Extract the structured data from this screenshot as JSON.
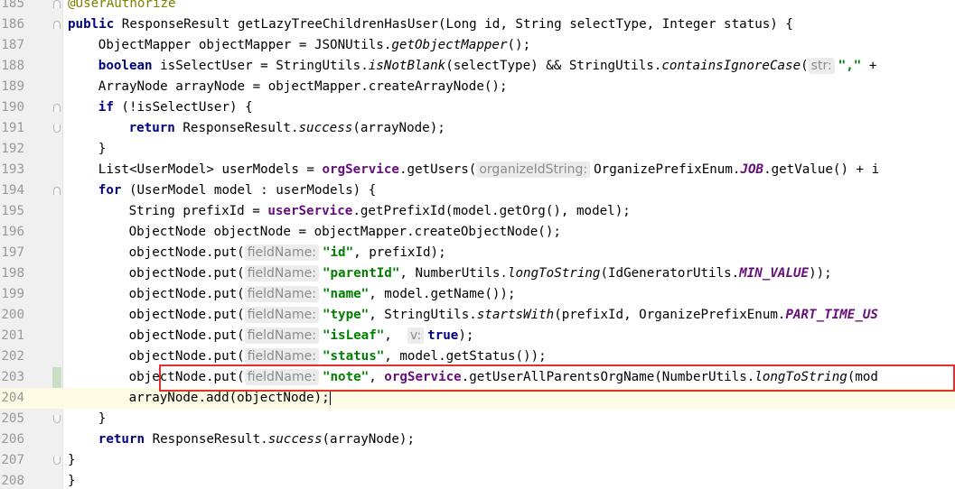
{
  "editor": {
    "lines": [
      {
        "num": "185",
        "indent": 1,
        "tokens": [
          {
            "t": "@UserAuthorize",
            "c": "ann"
          }
        ]
      },
      {
        "num": "186",
        "indent": 1,
        "tokens": [
          {
            "t": "public ",
            "c": "kw"
          },
          {
            "t": "ResponseResult getLazyTreeChildrenHasUser(Long id, String selectType, Integer status) {"
          }
        ]
      },
      {
        "num": "187",
        "indent": 2,
        "tokens": [
          {
            "t": "ObjectMapper objectMapper = JSONUtils."
          },
          {
            "t": "getObjectMapper",
            "c": "it"
          },
          {
            "t": "();"
          }
        ]
      },
      {
        "num": "188",
        "indent": 2,
        "tokens": [
          {
            "t": "boolean ",
            "c": "kw"
          },
          {
            "t": "isSelectUser = StringUtils."
          },
          {
            "t": "isNotBlank",
            "c": "it"
          },
          {
            "t": "(selectType) && StringUtils."
          },
          {
            "t": "containsIgnoreCase",
            "c": "it"
          },
          {
            "t": "("
          },
          {
            "t": "str:",
            "c": "hint"
          },
          {
            "t": "\",\"",
            "c": "str"
          },
          {
            "t": " +"
          }
        ]
      },
      {
        "num": "189",
        "indent": 2,
        "tokens": [
          {
            "t": "ArrayNode arrayNode = objectMapper.createArrayNode();"
          }
        ]
      },
      {
        "num": "190",
        "indent": 2,
        "tokens": [
          {
            "t": "if ",
            "c": "kw"
          },
          {
            "t": "(!isSelectUser) {"
          }
        ]
      },
      {
        "num": "191",
        "indent": 3,
        "tokens": [
          {
            "t": "return ",
            "c": "kw"
          },
          {
            "t": "ResponseResult."
          },
          {
            "t": "success",
            "c": "it"
          },
          {
            "t": "(arrayNode);"
          }
        ]
      },
      {
        "num": "192",
        "indent": 2,
        "tokens": [
          {
            "t": "}"
          }
        ]
      },
      {
        "num": "193",
        "indent": 2,
        "tokens": [
          {
            "t": "List<UserModel> userModels = "
          },
          {
            "t": "orgService",
            "c": "field"
          },
          {
            "t": ".getUsers("
          },
          {
            "t": "organizeIdString:",
            "c": "hint"
          },
          {
            "t": "OrganizePrefixEnum."
          },
          {
            "t": "JOB",
            "c": "const"
          },
          {
            "t": ".getValue() + i"
          }
        ]
      },
      {
        "num": "194",
        "indent": 2,
        "tokens": [
          {
            "t": "for ",
            "c": "kw"
          },
          {
            "t": "(UserModel model : userModels) {"
          }
        ]
      },
      {
        "num": "195",
        "indent": 3,
        "tokens": [
          {
            "t": "String prefixId = "
          },
          {
            "t": "userService",
            "c": "field"
          },
          {
            "t": ".getPrefixId(model.getOrg(), model);"
          }
        ]
      },
      {
        "num": "196",
        "indent": 3,
        "tokens": [
          {
            "t": "ObjectNode objectNode = objectMapper.createObjectNode();"
          }
        ]
      },
      {
        "num": "197",
        "indent": 3,
        "tokens": [
          {
            "t": "objectNode.put("
          },
          {
            "t": "fieldName:",
            "c": "hint"
          },
          {
            "t": "\"id\"",
            "c": "str"
          },
          {
            "t": ", prefixId);"
          }
        ]
      },
      {
        "num": "198",
        "indent": 3,
        "tokens": [
          {
            "t": "objectNode.put("
          },
          {
            "t": "fieldName:",
            "c": "hint"
          },
          {
            "t": "\"parentId\"",
            "c": "str"
          },
          {
            "t": ", NumberUtils."
          },
          {
            "t": "longToString",
            "c": "it"
          },
          {
            "t": "(IdGeneratorUtils."
          },
          {
            "t": "MIN_VALUE",
            "c": "const"
          },
          {
            "t": "));"
          }
        ]
      },
      {
        "num": "199",
        "indent": 3,
        "tokens": [
          {
            "t": "objectNode.put("
          },
          {
            "t": "fieldName:",
            "c": "hint"
          },
          {
            "t": "\"name\"",
            "c": "str"
          },
          {
            "t": ", model.getName());"
          }
        ]
      },
      {
        "num": "200",
        "indent": 3,
        "tokens": [
          {
            "t": "objectNode.put("
          },
          {
            "t": "fieldName:",
            "c": "hint"
          },
          {
            "t": "\"type\"",
            "c": "str"
          },
          {
            "t": ", StringUtils."
          },
          {
            "t": "startsWith",
            "c": "it"
          },
          {
            "t": "(prefixId, OrganizePrefixEnum."
          },
          {
            "t": "PART_TIME_US",
            "c": "const"
          }
        ]
      },
      {
        "num": "201",
        "indent": 3,
        "tokens": [
          {
            "t": "objectNode.put("
          },
          {
            "t": "fieldName:",
            "c": "hint"
          },
          {
            "t": "\"isLeaf\"",
            "c": "str"
          },
          {
            "t": ",  "
          },
          {
            "t": "v:",
            "c": "hint"
          },
          {
            "t": "true",
            "c": "kw"
          },
          {
            "t": ");"
          }
        ]
      },
      {
        "num": "202",
        "indent": 3,
        "tokens": [
          {
            "t": "objectNode.put("
          },
          {
            "t": "fieldName:",
            "c": "hint"
          },
          {
            "t": "\"status\"",
            "c": "str"
          },
          {
            "t": ", model.getStatus());"
          }
        ]
      },
      {
        "num": "203",
        "indent": 3,
        "tokens": [
          {
            "t": "objectNode.put("
          },
          {
            "t": "fieldName:",
            "c": "hint"
          },
          {
            "t": "\"note\"",
            "c": "str"
          },
          {
            "t": ", "
          },
          {
            "t": "orgService",
            "c": "field"
          },
          {
            "t": ".getUserAllParentsOrgName(NumberUtils."
          },
          {
            "t": "longToString",
            "c": "it"
          },
          {
            "t": "(mod"
          }
        ]
      },
      {
        "num": "204",
        "indent": 3,
        "tokens": [
          {
            "t": "arrayNode.add(objectNode);"
          }
        ]
      },
      {
        "num": "205",
        "indent": 2,
        "tokens": [
          {
            "t": "}"
          }
        ]
      },
      {
        "num": "206",
        "indent": 2,
        "tokens": [
          {
            "t": "return ",
            "c": "kw"
          },
          {
            "t": "ResponseResult."
          },
          {
            "t": "success",
            "c": "it"
          },
          {
            "t": "(arrayNode);"
          }
        ]
      },
      {
        "num": "207",
        "indent": 1,
        "tokens": [
          {
            "t": "}"
          }
        ]
      },
      {
        "num": "208",
        "indent": 0,
        "tokens": [
          {
            "t": "}"
          }
        ]
      }
    ]
  }
}
